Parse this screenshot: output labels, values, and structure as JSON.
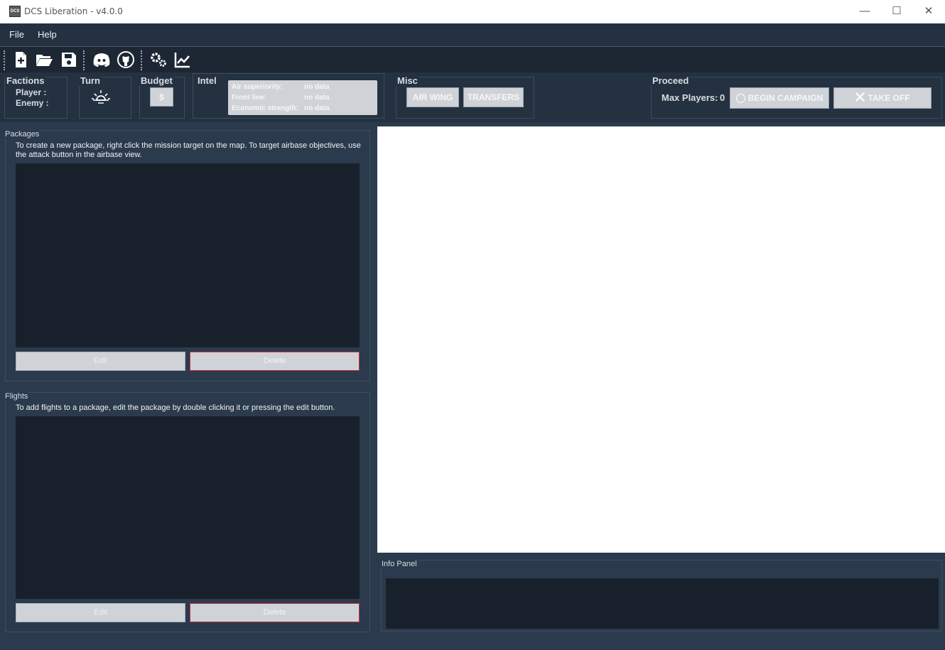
{
  "window": {
    "title": "DCS Liberation - v4.0.0",
    "app_icon_text": "DCS",
    "minimize_glyph": "—",
    "maximize_glyph": "☐",
    "close_glyph": "✕"
  },
  "menu": {
    "items": [
      "File",
      "Help"
    ]
  },
  "toolbar": {
    "icons": [
      "new-file-icon",
      "open-folder-icon",
      "save-icon",
      "discord-icon",
      "github-icon",
      "settings-icon",
      "stats-chart-icon"
    ]
  },
  "factions": {
    "title": "Factions",
    "player_label": "Player :",
    "enemy_label": "Enemy :"
  },
  "turn": {
    "title": "Turn",
    "icon": "sunrise-icon"
  },
  "budget": {
    "title": "Budget",
    "button_label": "$"
  },
  "intel": {
    "title": "Intel",
    "rows": [
      {
        "label": "Air superiority:",
        "value": "no data"
      },
      {
        "label": "Front line:",
        "value": "no data"
      },
      {
        "label": "Economic strength:",
        "value": "no data"
      }
    ]
  },
  "misc": {
    "title": "Misc",
    "air_wing_label": "AIR WING",
    "transfers_label": "TRANSFERS"
  },
  "proceed": {
    "title": "Proceed",
    "max_players_label": "Max Players:",
    "max_players_value": "0",
    "begin_campaign_label": "BEGIN CAMPAIGN",
    "take_off_label": "TAKE OFF"
  },
  "packages": {
    "title": "Packages",
    "hint": "To create a new package, right click the mission target on the map. To target airbase objectives, use the attack button in the airbase view.",
    "edit_label": "Edit",
    "delete_label": "Delete"
  },
  "flights": {
    "title": "Flights",
    "hint": "To add flights to a package, edit the package by double clicking it or pressing the edit button.",
    "edit_label": "Edit",
    "delete_label": "Delete"
  },
  "info_panel": {
    "title": "Info Panel"
  },
  "colors": {
    "background": "#2b3a4d",
    "list_bg": "#18212b",
    "button_gray": "#cfd3d8",
    "delete_border": "#c9313c"
  }
}
